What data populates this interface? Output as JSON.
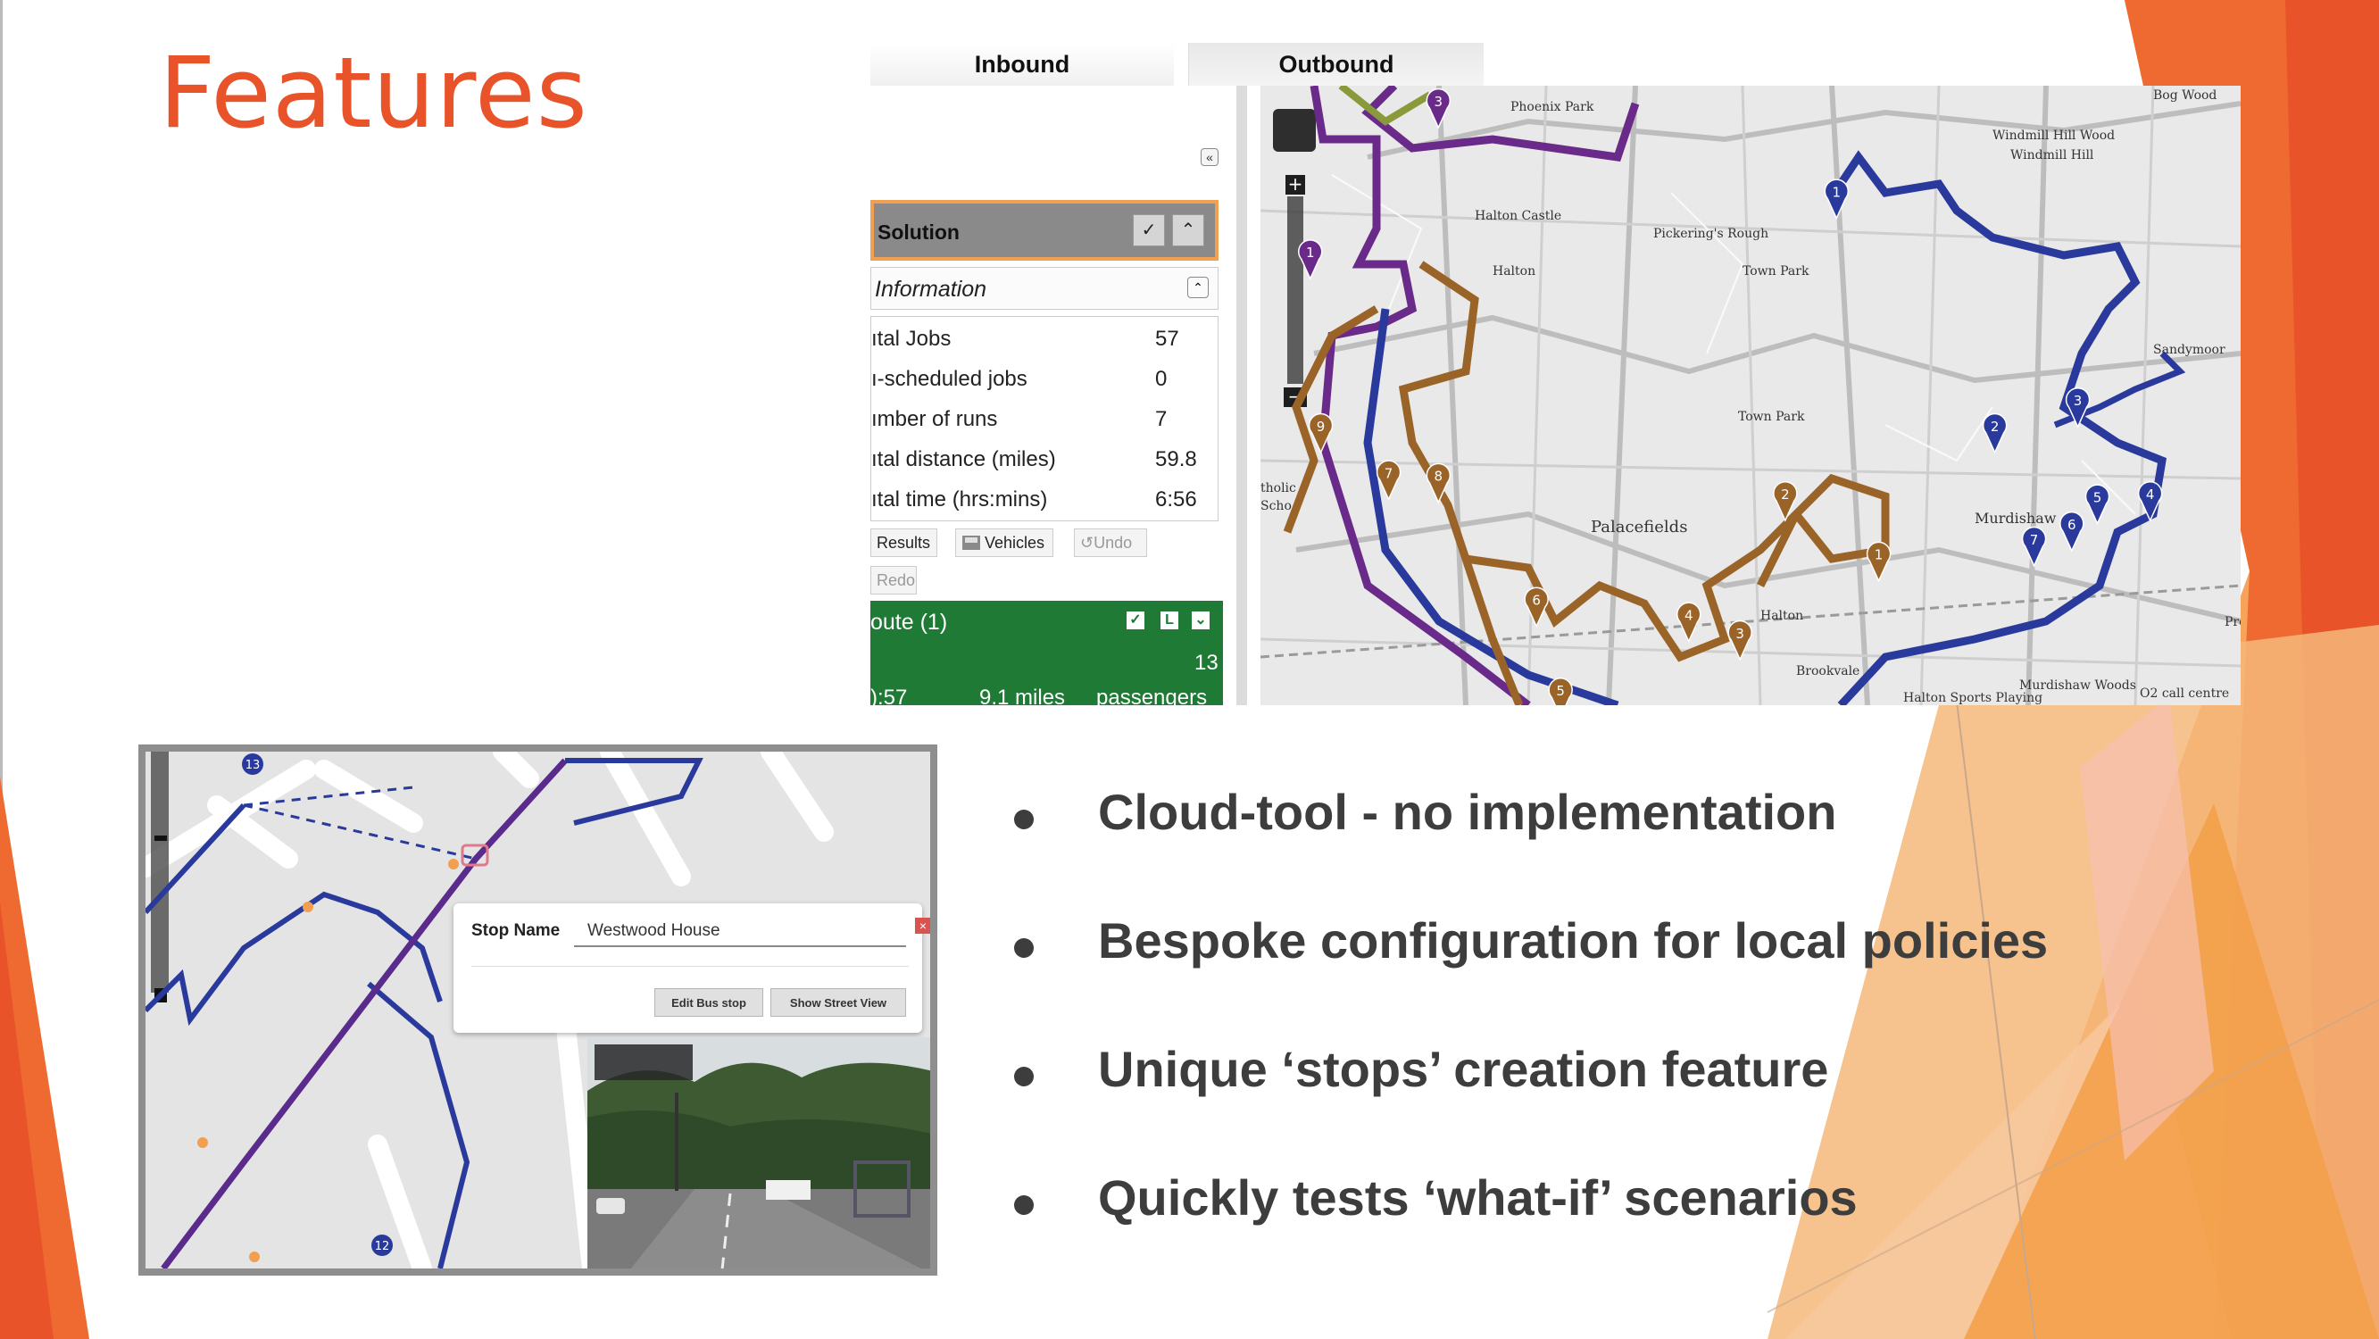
{
  "slide": {
    "title": "Features"
  },
  "scheduler": {
    "tabs": [
      {
        "label": "Inbound"
      },
      {
        "label": "Outbound"
      }
    ],
    "collapse_icon": "double-chevron-left-icon",
    "solution_label": "Solution",
    "information_label": "Information",
    "stats": [
      {
        "name": "ıtal Jobs",
        "value": "57"
      },
      {
        "name": "ı-scheduled jobs",
        "value": "0"
      },
      {
        "name": "ımber of runs",
        "value": "7"
      },
      {
        "name": "ıtal distance (miles)",
        "value": "59.8"
      },
      {
        "name": "ıtal time (hrs:mins)",
        "value": "6:56"
      }
    ],
    "buttons": {
      "results": "Results",
      "vehicles": "Vehicles",
      "undo": "Undo",
      "redo": "Redo"
    },
    "route": {
      "label": "oute (1)",
      "time": "):57",
      "distance": "9.1 miles",
      "passengers_count": "13",
      "passengers_label": "passengers",
      "check_label": "L"
    },
    "map": {
      "place_labels": [
        "Phoenix Park",
        "Bog Wood",
        "Windmill Hill Wood",
        "Windmill Hill",
        "Halton Castle",
        "Pickering's Rough",
        "Halton",
        "Town Park",
        "Sandymoor",
        "Town Park",
        "Palacefields",
        "Murdishaw",
        "Halton",
        "Brookvale",
        "Murdishaw Woods",
        "Halton Sports Playing",
        "O2 call centre",
        "tholic",
        "Scho",
        "Pre"
      ],
      "blue_markers": [
        "1",
        "2",
        "3",
        "4",
        "5",
        "6",
        "7"
      ],
      "brown_markers": [
        "1",
        "2",
        "3",
        "4",
        "5",
        "6",
        "7",
        "8",
        "9"
      ],
      "purple_markers": [
        "1",
        "3"
      ],
      "route_colors": {
        "blue": "#2a3a9c",
        "brown": "#9a6428",
        "purple": "#6a2a8a",
        "olive": "#8a9a3a"
      }
    }
  },
  "streetview": {
    "stop_name_label": "Stop Name",
    "stop_name_value": "Westwood House",
    "edit_button": "Edit Bus stop",
    "street_view_button": "Show Street View",
    "markers": [
      "13",
      "12"
    ]
  },
  "bullets": [
    "Cloud-tool - no implementation",
    "Bespoke configuration for local policies",
    "Unique ‘stops’ creation feature",
    "Quickly tests ‘what-if’ scenarios"
  ],
  "colors": {
    "title": "#e8532a",
    "accent_orange": "#f0a050",
    "route_green": "#1e7a35",
    "bullet_text": "#3d3d3d"
  }
}
